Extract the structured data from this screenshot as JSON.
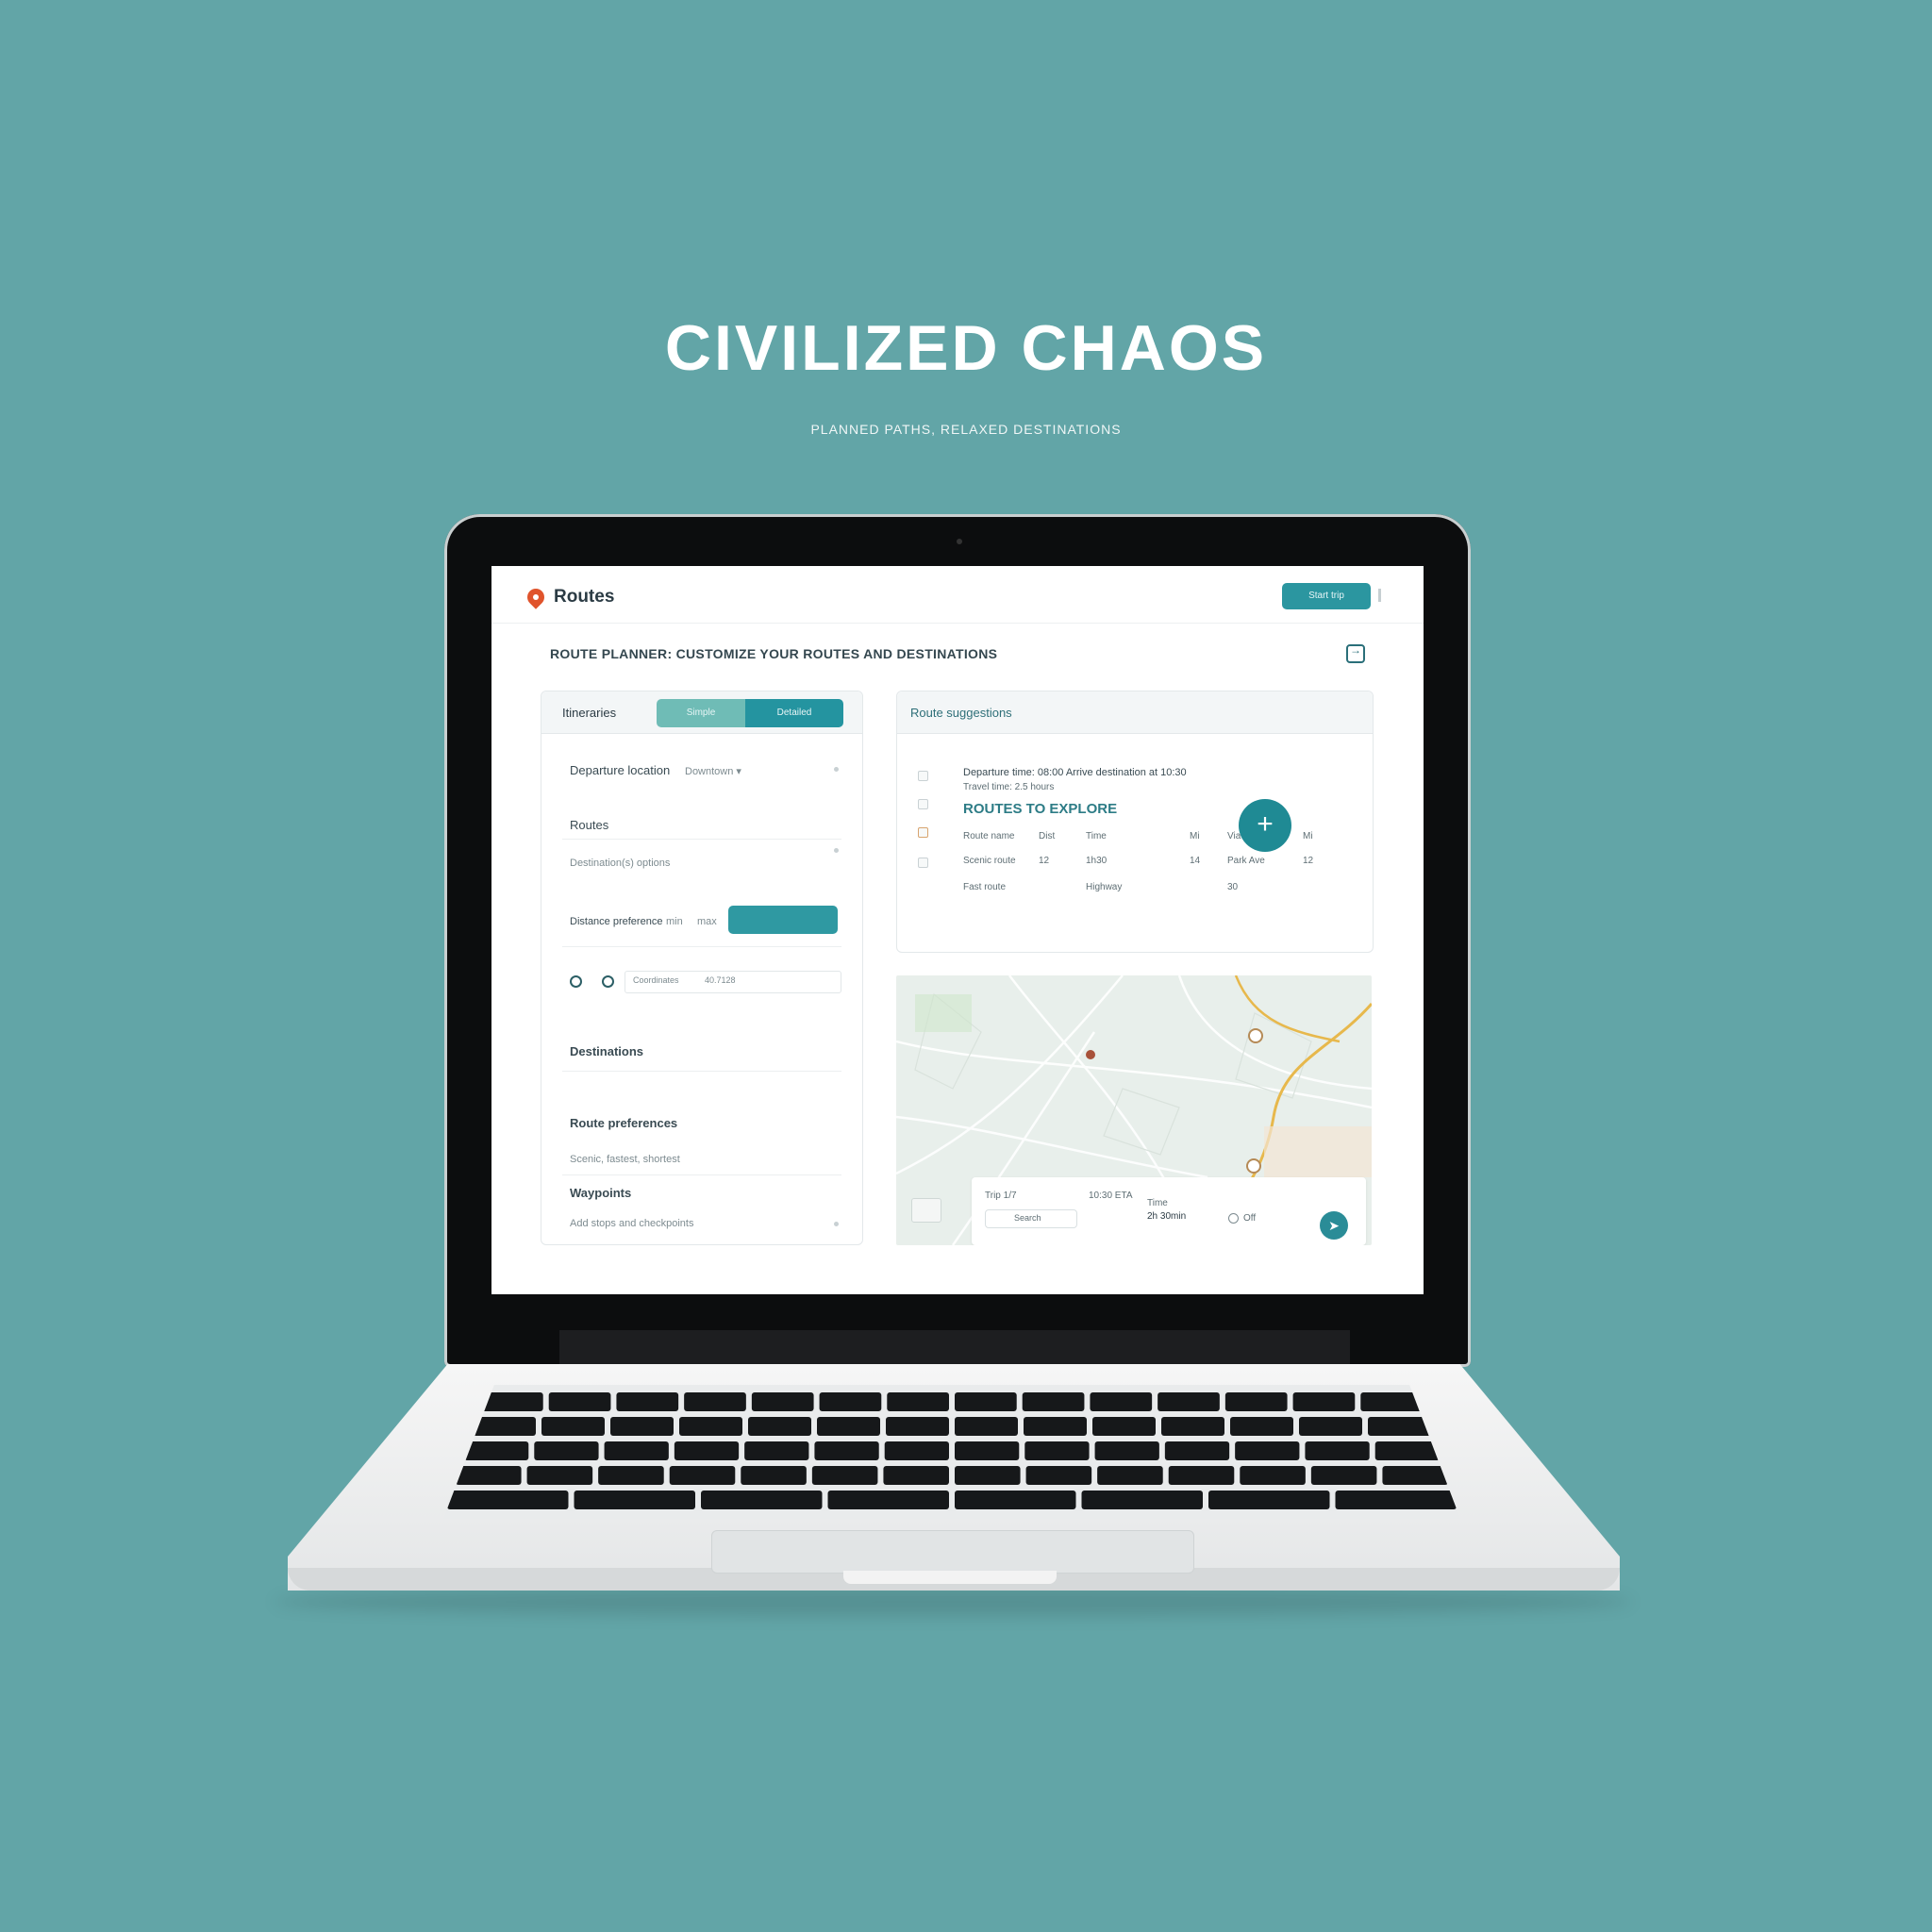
{
  "hero": {
    "title": "CIVILIZED CHAOS",
    "subtitle": "PLANNED PATHS, RELAXED DESTINATIONS"
  },
  "app": {
    "brand": "Routes",
    "header_button": "Start trip",
    "page_title": "ROUTE PLANNER: CUSTOMIZE YOUR ROUTES AND DESTINATIONS",
    "colors": {
      "accent": "#2494a0",
      "accent_light": "#6fbcb6",
      "logo": "#e0542c",
      "background": "#62a5a7"
    }
  },
  "left_panel": {
    "title": "Itineraries",
    "segments": [
      "Simple",
      "Detailed"
    ],
    "field1_label": "Departure location",
    "field1_value": "Downtown ▾",
    "field2_label": "Routes",
    "field2_hint": "Destination(s) options",
    "field3_label": "Distance preference",
    "field3_a": "min",
    "field3_b": "max",
    "coord_label": "Coordinates",
    "coord_value": "40.7128",
    "section1": "Destinations",
    "section2": "Route preferences",
    "section2_hint": "Scenic, fastest, shortest",
    "section3": "Waypoints",
    "section3_hint": "Add stops and checkpoints"
  },
  "right_panel": {
    "title": "Route suggestions",
    "line1": "Departure time: 08:00 Arrive destination at 10:30",
    "line2": "Travel time: 2.5 hours",
    "headline": "ROUTES TO EXPLORE",
    "fab_icon": "plus-icon",
    "rows": [
      [
        "Route name",
        "Dist",
        "Time",
        "Mi",
        "Via",
        "Mi"
      ],
      [
        "Scenic route",
        "12",
        "1h30",
        "14",
        "Park Ave",
        "12"
      ],
      [
        "Fast route",
        "",
        "Highway",
        "",
        "30",
        ""
      ]
    ]
  },
  "map": {
    "trip_label": "Trip 1/7",
    "eta": "10:30 ETA",
    "field": "Search",
    "duration_label": "Time",
    "duration_value": "2h 30min",
    "toggle": "Off",
    "nav_icon": "navigate-icon"
  }
}
